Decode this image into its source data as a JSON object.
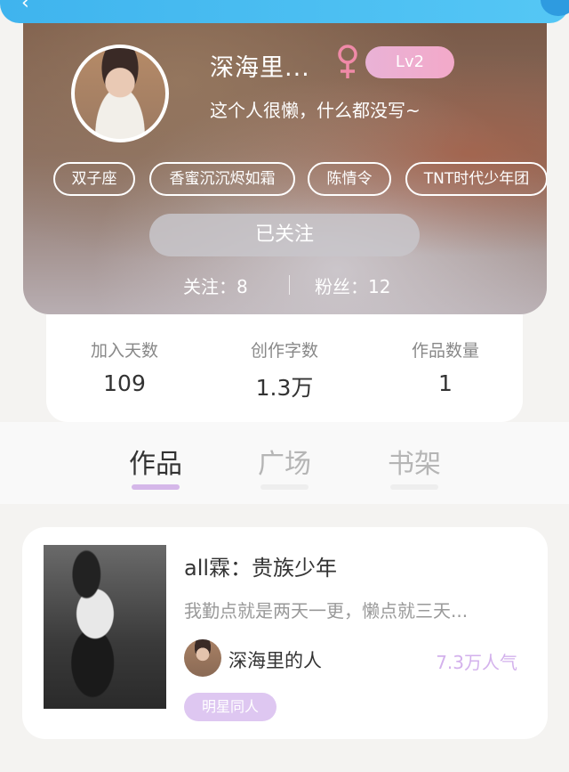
{
  "profile": {
    "nickname": "深海里...",
    "gender": "female",
    "level": "Lv2",
    "bio": "这个人很懒，什么都没写~",
    "tags": [
      "双子座",
      "香蜜沉沉烬如霜",
      "陈情令",
      "TNT时代少年团"
    ],
    "follow_button": "已关注",
    "following_label": "关注：",
    "following_count": "8",
    "fans_label": "粉丝：",
    "fans_count": "12"
  },
  "stats": [
    {
      "label": "加入天数",
      "value": "109"
    },
    {
      "label": "创作字数",
      "value": "1.3万"
    },
    {
      "label": "作品数量",
      "value": "1"
    }
  ],
  "tabs": [
    {
      "label": "作品",
      "active": true
    },
    {
      "label": "广场",
      "active": false
    },
    {
      "label": "书架",
      "active": false
    }
  ],
  "work": {
    "title": "all霖：贵族少年",
    "description": "我勤点就是两天一更，懒点就三天...",
    "author": "深海里的人",
    "popularity": "7.3万人气",
    "category": "明星同人"
  },
  "colors": {
    "topbar": "#3fb4ee",
    "accent_purple": "#d3b1ec",
    "level_badge": "#f3a9c9",
    "gender_icon": "#f08aa8"
  }
}
